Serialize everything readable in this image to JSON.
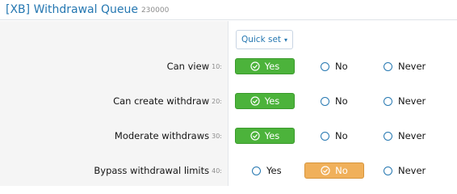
{
  "header": {
    "title": "[XB] Withdrawal Queue",
    "id": "230000"
  },
  "quick_set": {
    "label": "Quick set",
    "caret": "▾"
  },
  "permissions": [
    {
      "label": "Can view",
      "num": "10:",
      "yes": "Yes",
      "no": "No",
      "never": "Never",
      "selected": "yes"
    },
    {
      "label": "Can create withdraw",
      "num": "20:",
      "yes": "Yes",
      "no": "No",
      "never": "Never",
      "selected": "yes"
    },
    {
      "label": "Moderate withdraws",
      "num": "30:",
      "yes": "Yes",
      "no": "No",
      "never": "Never",
      "selected": "yes"
    },
    {
      "label": "Bypass withdrawal limits",
      "num": "40:",
      "yes": "Yes",
      "no": "No",
      "never": "Never",
      "selected": "no"
    }
  ],
  "colors": {
    "accent": "#2577b1",
    "yes_selected": "#4cb33b",
    "no_selected": "#f0b05a"
  },
  "icons": {
    "selected": "check-circle-icon",
    "unselected": "radio-circle-icon"
  }
}
